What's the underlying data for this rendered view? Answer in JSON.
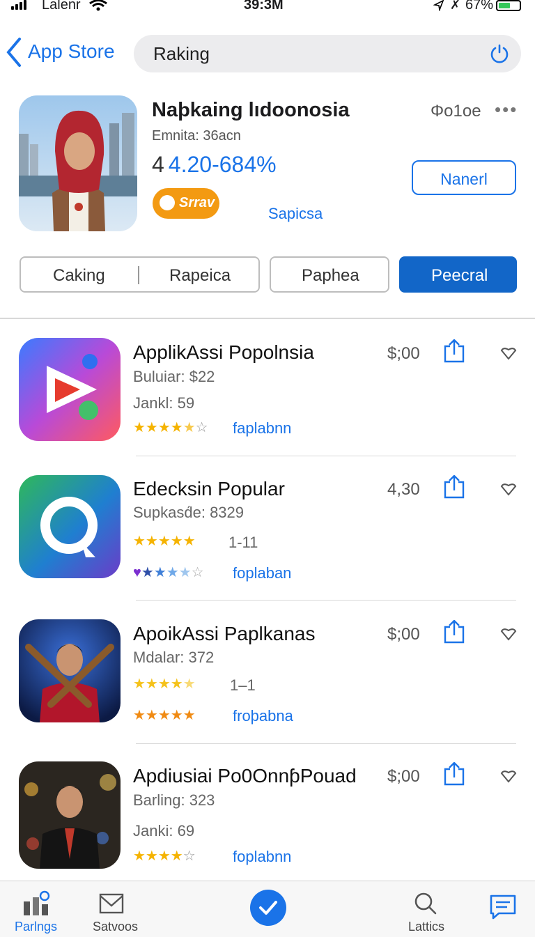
{
  "status": {
    "carrier": "Lalenr",
    "time": "39:3M",
    "battery": "67%"
  },
  "nav": {
    "back_label": "App Store",
    "search_text": "Raking"
  },
  "featured": {
    "title": "Naþkaing lıdoonosia",
    "subtitle": "Emnita: 36acn",
    "price_prefix": "4",
    "price": "4.20-684%",
    "badge": "Srrav",
    "link": "Sapicsa",
    "stat": "Φo1oe",
    "more": "•••",
    "action_button": "Nanerl"
  },
  "segments": [
    {
      "label": "Caking"
    },
    {
      "label": "Rapeica"
    },
    {
      "label": "Paphea"
    },
    {
      "label": "Peecral"
    }
  ],
  "apps": [
    {
      "title": "ApplikAssi Popolnsia",
      "meta1": "Buluiar: $22",
      "meta2": "Jankl: 59",
      "price": "$;00",
      "rating": 4.5,
      "link": "faplabnn"
    },
    {
      "title": "Edecksin Popular",
      "meta1": "Supkasd́e: 8329",
      "rating_text": "1-11",
      "price": "4,30",
      "rating": 5,
      "link": "foplaban"
    },
    {
      "title": "ApoikAssi Paplkanas",
      "meta1": "Mdalar: 372",
      "rating_text": "1–1",
      "price": "$;00",
      "rating": 4.5,
      "link": "froþabna"
    },
    {
      "title": "Apdiusiai Po0OnnƥPouad",
      "meta1": "Barling: 323",
      "meta2": "Janki: 69",
      "price": "$;00",
      "rating": 4,
      "link": "foplabnn"
    }
  ],
  "tabs": [
    {
      "label": "Parlngs"
    },
    {
      "label": "Satvoos"
    },
    {
      "label": "Lattics"
    }
  ],
  "colors": {
    "accent": "#1a73e8",
    "active_segment": "#1266c8",
    "badge": "#f39a12",
    "star": "#f5b301"
  }
}
